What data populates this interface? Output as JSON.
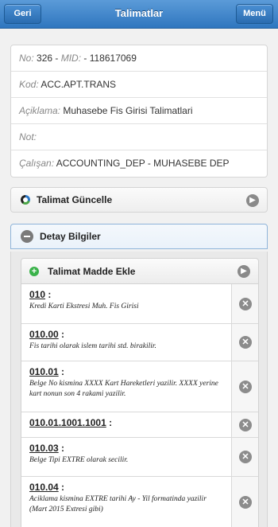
{
  "header": {
    "back_label": "Geri",
    "title": "Talimatlar",
    "menu_label": "Menü"
  },
  "info": {
    "no_label": "No:",
    "no_value": " 326 - ",
    "mid_label": "MID:",
    "mid_value": " - 118617069",
    "kod_label": "Kod:",
    "kod_value": " ACC.APT.TRANS",
    "aciklama_label": "Açiklama:",
    "aciklama_value": " Muhasebe Fis Girisi Talimatlari",
    "not_label": "Not:",
    "calisan_label": "Çalışan:",
    "calisan_value": " ACCOUNTING_DEP - MUHASEBE DEP"
  },
  "sections": {
    "update_label": "Talimat Güncelle",
    "detail_label": "Detay Bilgiler",
    "add_item_label": "Talimat Madde Ekle"
  },
  "items": [
    {
      "code": "010",
      "desc": "Kredi Karti Ekstresi Muh. Fis Girisi"
    },
    {
      "code": "010.00",
      "desc": "Fis tarihi olarak islem tarihi std. birakilir."
    },
    {
      "code": "010.01",
      "desc": "Belge No kismina XXXX Kart Hareketleri yazilir. XXXX yerine kart nonun son 4 rakami yazilir."
    },
    {
      "code": "010.01.1001.1001",
      "desc": ""
    },
    {
      "code": "010.03",
      "desc": "Belge Tipi EXTRE olarak secilir."
    },
    {
      "code": "010.04",
      "desc": "Aciklama kismina EXTRE tarihi Ay - Yil formatinda yazilir (Mart 2015 Extresi gibi)"
    }
  ]
}
